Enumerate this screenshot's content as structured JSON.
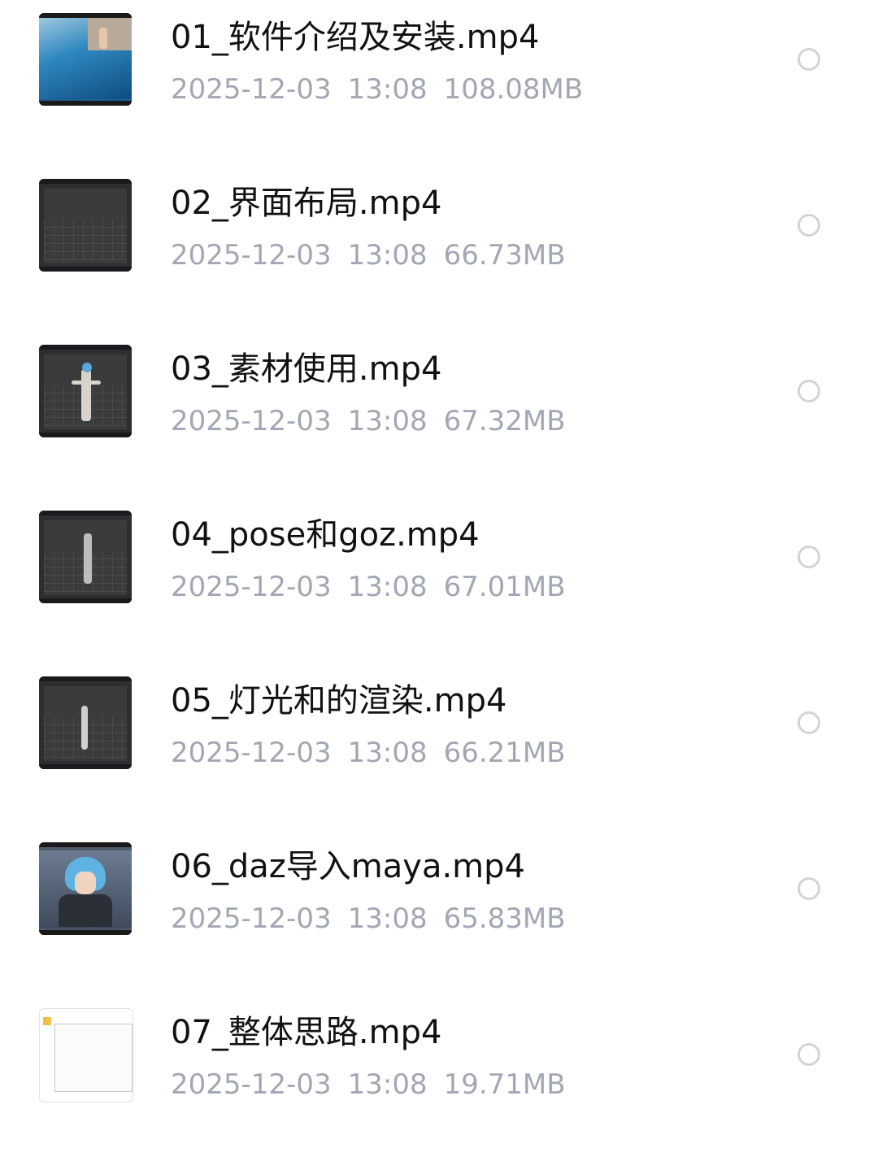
{
  "files": [
    {
      "name": "01_软件介绍及安装.mp4",
      "date": "2025-12-03",
      "time": "13:08",
      "size": "108.08MB",
      "thumb_icon": "video-thumbnail-pool-scene",
      "selected": false
    },
    {
      "name": "02_界面布局.mp4",
      "date": "2025-12-03",
      "time": "13:08",
      "size": "66.73MB",
      "thumb_icon": "video-thumbnail-3d-viewport",
      "selected": false
    },
    {
      "name": "03_素材使用.mp4",
      "date": "2025-12-03",
      "time": "13:08",
      "size": "67.32MB",
      "thumb_icon": "video-thumbnail-3d-figure",
      "selected": false
    },
    {
      "name": "04_pose和goz.mp4",
      "date": "2025-12-03",
      "time": "13:08",
      "size": "67.01MB",
      "thumb_icon": "video-thumbnail-3d-figure",
      "selected": false
    },
    {
      "name": "05_灯光和的渲染.mp4",
      "date": "2025-12-03",
      "time": "13:08",
      "size": "66.21MB",
      "thumb_icon": "video-thumbnail-3d-figure",
      "selected": false
    },
    {
      "name": "06_daz导入maya.mp4",
      "date": "2025-12-03",
      "time": "13:08",
      "size": "65.83MB",
      "thumb_icon": "video-thumbnail-anime-character",
      "selected": false
    },
    {
      "name": "07_整体思路.mp4",
      "date": "2025-12-03",
      "time": "13:08",
      "size": "19.71MB",
      "thumb_icon": "video-thumbnail-file-explorer",
      "selected": false
    }
  ],
  "colors": {
    "title": "#111111",
    "meta": "#a3a7b4",
    "radio_border": "#d2d4d9",
    "background": "#ffffff"
  }
}
